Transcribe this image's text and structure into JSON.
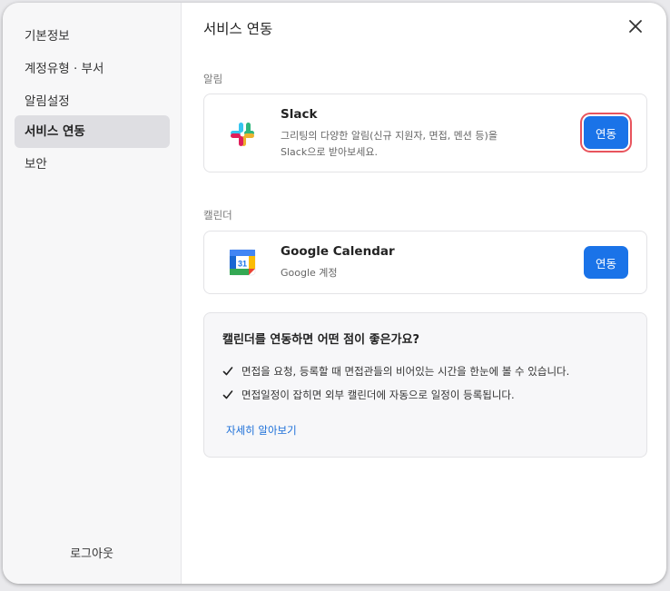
{
  "sidebar": {
    "items": [
      {
        "label": "기본정보"
      },
      {
        "label": "계정유형 · 부서"
      },
      {
        "label": "알림설정"
      },
      {
        "label": "서비스 연동"
      },
      {
        "label": "보안"
      }
    ],
    "logout_label": "로그아웃"
  },
  "main": {
    "title": "서비스 연동",
    "notifications": {
      "section_label": "알림",
      "slack": {
        "name": "Slack",
        "desc_line1": "그리팅의 다양한 알림(신규 지원자, 면접, 멘션 등)을",
        "desc_line2": "Slack으로 받아보세요.",
        "button_label": "연동"
      }
    },
    "calendar": {
      "section_label": "캘린더",
      "google": {
        "name": "Google Calendar",
        "desc": "Google 계정",
        "icon_day": "31",
        "button_label": "연동"
      }
    },
    "info": {
      "title": "캘린더를 연동하면 어떤 점이 좋은가요?",
      "benefits": [
        "면접을 요청, 등록할 때 면접관들의 비어있는 시간을 한눈에 볼 수 있습니다.",
        "면접일정이 잡히면 외부 캘린더에 자동으로 일정이 등록됩니다."
      ],
      "learn_more": "자세히 알아보기"
    }
  },
  "colors": {
    "accent": "#1a73e8",
    "focus_ring": "#e8545d",
    "active_item_bg": "#dedee2"
  }
}
